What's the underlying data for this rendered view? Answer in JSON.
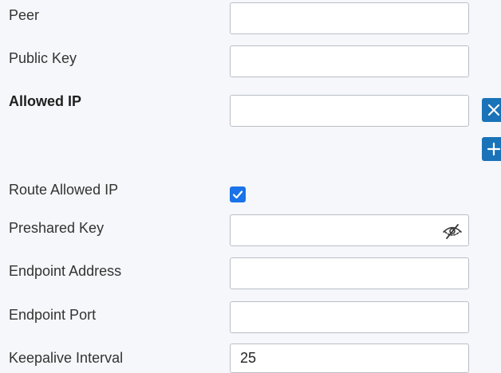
{
  "form": {
    "peer": {
      "label": "Peer",
      "value": ""
    },
    "public_key": {
      "label": "Public Key",
      "value": ""
    },
    "allowed_ip": {
      "label": "Allowed IP",
      "value": ""
    },
    "route_allowed_ip": {
      "label": "Route Allowed IP",
      "checked": true
    },
    "preshared_key": {
      "label": "Preshared Key",
      "value": ""
    },
    "endpoint_address": {
      "label": "Endpoint Address",
      "value": ""
    },
    "endpoint_port": {
      "label": "Endpoint Port",
      "value": ""
    },
    "keepalive_interval": {
      "label": "Keepalive Interval",
      "value": "25"
    }
  },
  "icons": {
    "remove": "close-icon",
    "add": "plus-icon",
    "check": "checkmark-icon",
    "visibility": "eye-slash-icon"
  },
  "colors": {
    "action_button": "#1a73b8",
    "checkbox": "#1a73e8",
    "field_border": "#b9bec6",
    "background": "#f5f7fa"
  }
}
